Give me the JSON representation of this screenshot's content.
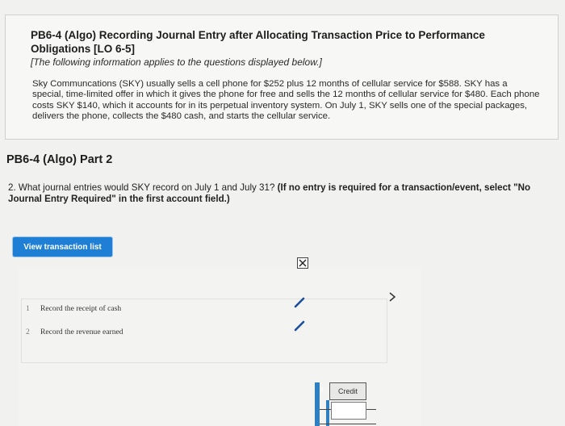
{
  "problem": {
    "title": "PB6-4 (Algo) Recording Journal Entry after Allocating Transaction Price to Performance Obligations [LO 6-5]",
    "note": "[The following information applies to the questions displayed below.]",
    "paragraph": "Sky Communcations (SKY) usually sells a cell phone for $252 plus 12 months of cellular service for $588. SKY has a special, time-limited offer in which it gives the phone for free and sells the 12 months of cellular service for $480. Each phone costs SKY $140, which it accounts for in its perpetual inventory system. On July 1, SKY sells one of the special packages, delivers the phone, collects the $480 cash, and starts the cellular service."
  },
  "part": {
    "title": "PB6-4 (Algo) Part 2"
  },
  "question": {
    "text": "2. What journal entries would SKY record on July 1 and July 31? ",
    "instruction": "(If no entry is required for a transaction/event, select \"No Journal Entry Required\" in the first account field.)"
  },
  "buttons": {
    "view_transaction_list": "View transaction list"
  },
  "entries": [
    {
      "num": "1",
      "label": "Record the receipt of cash"
    },
    {
      "num": "2",
      "label": "Record the revenue earned"
    }
  ],
  "table": {
    "credit_header": "Credit",
    "row_marker": "1"
  },
  "colors": {
    "accent": "#1f7fd4",
    "bar": "#2f80c2"
  },
  "icons": [
    "close-icon",
    "pencil-icon",
    "chevron-right-icon"
  ]
}
